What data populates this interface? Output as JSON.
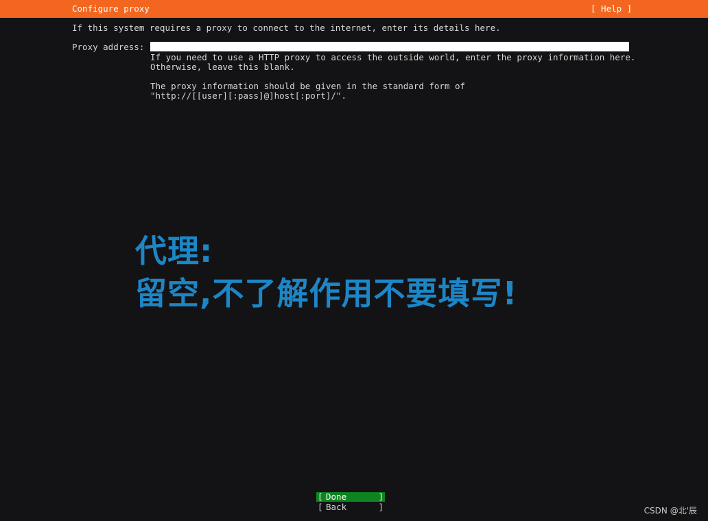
{
  "header": {
    "title": "Configure proxy",
    "help_label": "[ Help ]"
  },
  "intro_text": "If this system requires a proxy to connect to the internet, enter its details here.",
  "proxy_field": {
    "label": "Proxy address:",
    "value": "",
    "help_lines": [
      "If you need to use a HTTP proxy to access the outside world, enter the proxy information here.",
      "Otherwise, leave this blank.",
      "The proxy information should be given in the standard form of",
      "\"http://[[user][:pass]@]host[:port]/\"."
    ]
  },
  "overlay_annotation": {
    "line1": "代理:",
    "line2": "留空,不了解作用不要填写!"
  },
  "buttons": {
    "done": {
      "bracket_left": "[",
      "label": "Done",
      "bracket_right": "]"
    },
    "back": {
      "bracket_left": "[",
      "label": "Back",
      "bracket_right": "]"
    }
  },
  "watermark": "CSDN @北'辰",
  "colors": {
    "header_bg": "#f2661f",
    "background": "#131315",
    "focus_bg": "#0e8420",
    "overlay_text": "#1d86c6"
  }
}
